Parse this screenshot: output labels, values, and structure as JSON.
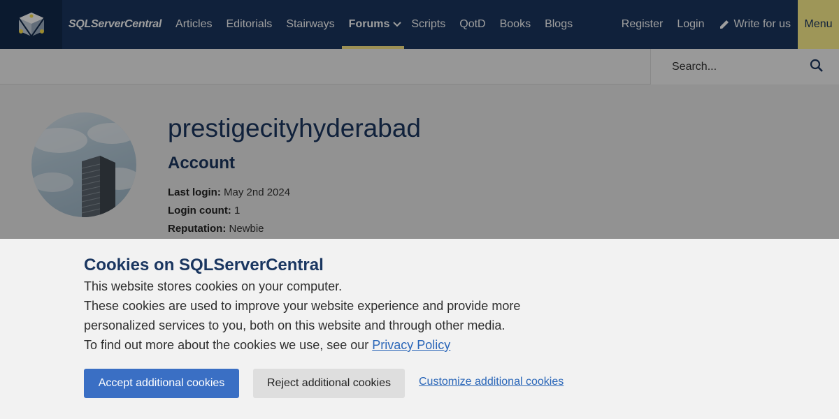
{
  "nav": {
    "brand": "SQLServerCentral",
    "items": [
      "Articles",
      "Editorials",
      "Stairways",
      "Forums",
      "Scripts",
      "QotD",
      "Books",
      "Blogs"
    ],
    "active": "Forums",
    "right": {
      "register": "Register",
      "login": "Login",
      "write": "Write for us",
      "menu": "Menu"
    },
    "colors": {
      "bar": "#1a3660",
      "accent": "#fff28f"
    }
  },
  "search": {
    "placeholder": "Search..."
  },
  "profile": {
    "username": "prestigecityhyderabad",
    "section_heading": "Account",
    "last_login_label": "Last login:",
    "last_login_value": "May 2nd 2024",
    "login_count_label": "Login count:",
    "login_count_value": "1",
    "reputation_label": "Reputation:",
    "reputation_value": "Newbie"
  },
  "cookie_banner": {
    "title": "Cookies on SQLServerCentral",
    "line1": "This website stores cookies on your computer.",
    "line2": "These cookies are used to improve your website experience and provide more personalized services to you, both on this website and through other media.",
    "line3_prefix": "To find out more about the cookies we use, see our",
    "privacy_link": "Privacy Policy",
    "accept_label": "Accept additional cookies",
    "reject_label": "Reject additional cookies",
    "customize_label": "Customize additional cookies"
  }
}
